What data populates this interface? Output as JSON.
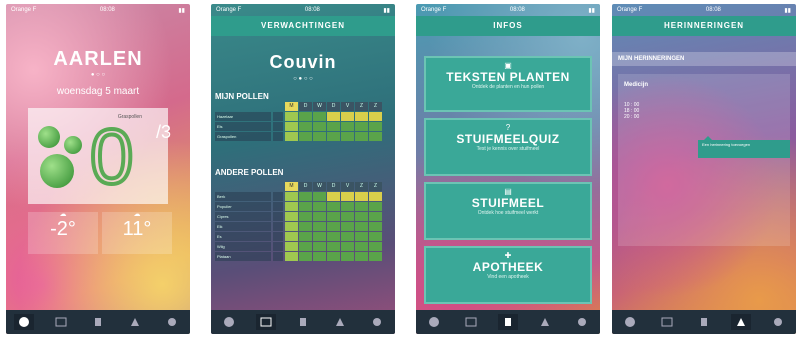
{
  "status": {
    "carrier": "Orange F",
    "time": "08:08"
  },
  "phone1": {
    "city": "AARLEN",
    "date": "woensdag 5 maart",
    "card_label": "Graspollen",
    "pollen_value": "0",
    "pollen_max": "/3",
    "temp_min": "-2°",
    "temp_max": "11°"
  },
  "phone2": {
    "header": "VERWACHTINGEN",
    "city": "Couvin",
    "section_mine": "MIJN POLLEN",
    "section_other": "ANDERE POLLEN",
    "days": [
      "M",
      "D",
      "W",
      "D",
      "V",
      "Z",
      "Z"
    ],
    "mine_rows": [
      "Hazelaar",
      "Els",
      "Graspollen"
    ],
    "other_rows": [
      "Berk",
      "Populier",
      "Cipres",
      "Eik",
      "Es",
      "Wilg",
      "Plataan"
    ]
  },
  "phone3": {
    "header": "INFOS",
    "cards": [
      {
        "title": "TEKSTEN PLANTEN",
        "sub": "Ontdek de planten en hun pollen"
      },
      {
        "title": "STUIFMEELQUIZ",
        "sub": "Test je kennis over stuifmeel"
      },
      {
        "title": "STUIFMEEL",
        "sub": "Ontdek hoe stuifmeel werkt"
      },
      {
        "title": "APOTHEEK",
        "sub": "Vind een apotheek"
      }
    ]
  },
  "phone4": {
    "header": "HERINNERINGEN",
    "subheader": "MIJN HERINNERINGEN",
    "med_label": "Medicijn",
    "times": [
      "10 : 00",
      "18 : 00",
      "20 : 00"
    ],
    "add_button": "Een herinnering toevoegen"
  },
  "nav": [
    "home-icon",
    "calendar-icon",
    "info-icon",
    "reminder-icon",
    "settings-icon"
  ]
}
